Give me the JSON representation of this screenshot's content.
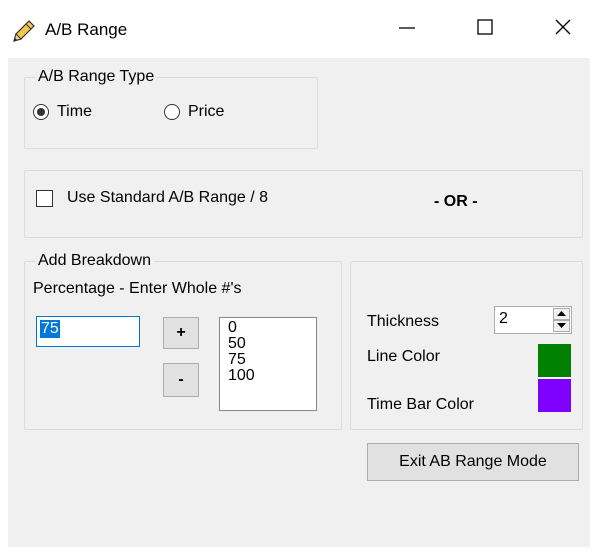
{
  "window": {
    "title": "A/B Range",
    "icons": {
      "app": "pencil-icon",
      "minimize": "minimize-icon",
      "maximize": "maximize-icon",
      "close": "close-icon"
    }
  },
  "range_type": {
    "legend": "A/B Range Type",
    "options": [
      {
        "label": "Time",
        "selected": true
      },
      {
        "label": "Price",
        "selected": false
      }
    ]
  },
  "standard": {
    "checkbox_label": "Use Standard A/B Range / 8",
    "checked": false,
    "or_text": "- OR -"
  },
  "breakdown": {
    "legend": "Add Breakdown",
    "hint": "Percentage - Enter Whole #'s",
    "input_value": "75",
    "add_label": "+",
    "remove_label": "-",
    "list_items": [
      "0",
      "50",
      "75",
      "100"
    ]
  },
  "style": {
    "thickness_label": "Thickness",
    "thickness_value": "2",
    "line_color_label": "Line Color",
    "line_color": "#008000",
    "time_bar_color_label": "Time Bar Color",
    "time_bar_color": "#8000ff"
  },
  "exit_button_label": "Exit AB Range Mode"
}
